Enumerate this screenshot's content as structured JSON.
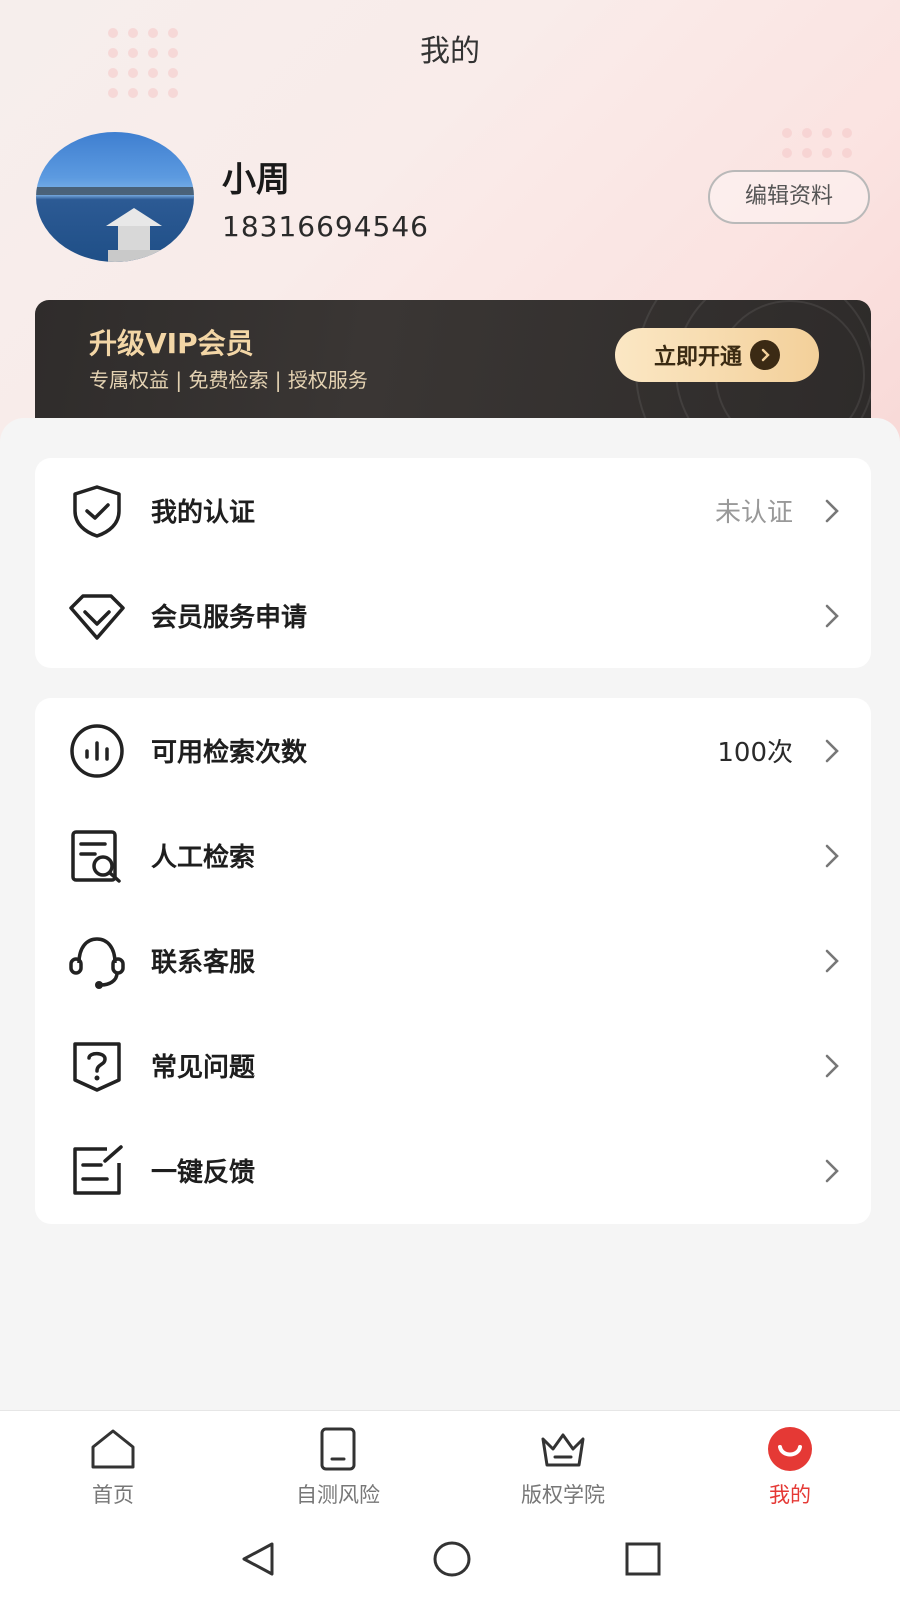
{
  "header": {
    "title": "我的"
  },
  "profile": {
    "name": "小周",
    "phone": "18316694546",
    "edit_label": "编辑资料"
  },
  "vip": {
    "title": "升级VIP会员",
    "subtitle": "专属权益 | 免费检索 | 授权服务",
    "button_label": "立即开通",
    "accent": "#f3d6a6"
  },
  "menu_group_1": [
    {
      "icon": "shield-check-icon",
      "label": "我的认证",
      "value": "未认证"
    },
    {
      "icon": "diamond-icon",
      "label": "会员服务申请",
      "value": ""
    }
  ],
  "menu_group_2": [
    {
      "icon": "bar-chart-circle-icon",
      "label": "可用检索次数",
      "value": "100次"
    },
    {
      "icon": "document-search-icon",
      "label": "人工检索",
      "value": ""
    },
    {
      "icon": "headset-icon",
      "label": "联系客服",
      "value": ""
    },
    {
      "icon": "question-shield-icon",
      "label": "常见问题",
      "value": ""
    },
    {
      "icon": "feedback-edit-icon",
      "label": "一键反馈",
      "value": ""
    }
  ],
  "tabbar": [
    {
      "icon": "home-icon",
      "label": "首页",
      "active": false
    },
    {
      "icon": "tablet-icon",
      "label": "自测风险",
      "active": false
    },
    {
      "icon": "crown-icon",
      "label": "版权学院",
      "active": false
    },
    {
      "icon": "smile-icon",
      "label": "我的",
      "active": true
    }
  ],
  "colors": {
    "active_tab": "#e53935",
    "brand_dark": "#2f2c2b"
  }
}
